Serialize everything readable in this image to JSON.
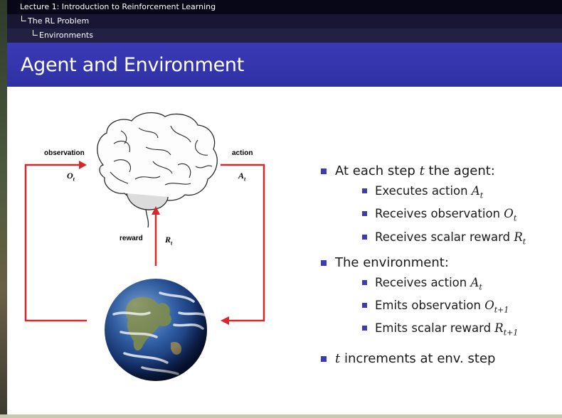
{
  "nav": {
    "lecture": "Lecture 1: Introduction to Reinforcement Learning",
    "section": "The RL Problem",
    "subsection": "Environments"
  },
  "slide": {
    "title": "Agent and Environment"
  },
  "diagram": {
    "observation_label": "observation",
    "observation_symbol": "O",
    "observation_sub": "t",
    "action_label": "action",
    "action_symbol": "A",
    "action_sub": "t",
    "reward_label": "reward",
    "reward_symbol": "R",
    "reward_sub": "t",
    "arrow_color": "#d6282a"
  },
  "bullets": [
    {
      "text": "At each step ",
      "var": "t",
      "suffix": " the agent:",
      "sub": [
        {
          "text": "Executes action ",
          "sym": "A",
          "sym_sub": "t"
        },
        {
          "text": "Receives observation ",
          "sym": "O",
          "sym_sub": "t"
        },
        {
          "text": "Receives scalar reward ",
          "sym": "R",
          "sym_sub": "t"
        }
      ]
    },
    {
      "text": "The environment:",
      "var": "",
      "suffix": "",
      "sub": [
        {
          "text": "Receives action ",
          "sym": "A",
          "sym_sub": "t"
        },
        {
          "text": "Emits observation ",
          "sym": "O",
          "sym_sub": "t+1"
        },
        {
          "text": "Emits scalar reward ",
          "sym": "R",
          "sym_sub": "t+1"
        }
      ]
    },
    {
      "text": "",
      "var": "t",
      "suffix": " increments at env. step",
      "sub": []
    }
  ],
  "colors": {
    "accent": "#3b3bb6",
    "nav_bg": "#070717",
    "title_bg": "#3434ad"
  }
}
